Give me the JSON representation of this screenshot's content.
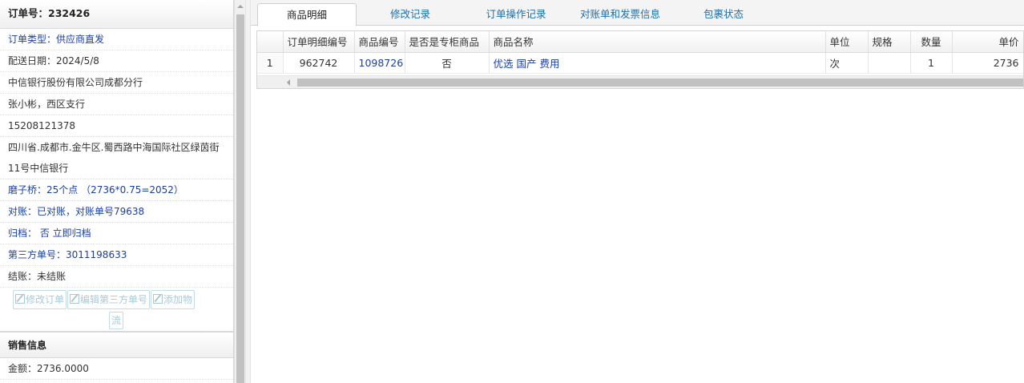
{
  "order": {
    "header_label": "订单号：232426",
    "rows": [
      {
        "text": "订单类型：供应商直发",
        "style": "blue"
      },
      {
        "text": "配送日期：2024/5/8",
        "style": "plain"
      },
      {
        "text": "中信银行股份有限公司成都分行",
        "style": "plain"
      },
      {
        "text": "张小彬，西区支行",
        "style": "plain"
      },
      {
        "text": "15208121378",
        "style": "plain"
      },
      {
        "text": "四川省.成都市.金牛区.蜀西路中海国际社区绿茵街11号中信银行",
        "style": "wrap"
      },
      {
        "text": "磨子桥：25个点  （2736*0.75=2052）",
        "style": "blue"
      },
      {
        "text": "对账：已对账，对账单号79638",
        "style": "blue"
      },
      {
        "text": "归档：  否 立即归档",
        "style": "blue"
      },
      {
        "text": "第三方单号：3011198633",
        "style": "blue"
      },
      {
        "text": "结账：未结账",
        "style": "plain"
      }
    ],
    "buttons": {
      "edit_order": "修改订单",
      "edit_third_party": "编辑第三方单号",
      "add_logistics": "添加物",
      "add_logistics_wrap": "流"
    }
  },
  "sales": {
    "header_label": "销售信息",
    "amount": "金额：2736.0000"
  },
  "tabs": [
    {
      "label": "商品明细",
      "active": true
    },
    {
      "label": "修改记录",
      "active": false
    },
    {
      "label": "订单操作记录",
      "active": false
    },
    {
      "label": "对账单和发票信息",
      "active": false
    },
    {
      "label": "包裹状态",
      "active": false
    }
  ],
  "grid": {
    "columns": [
      "",
      "订单明细编号",
      "商品编号",
      "是否是专柜商品",
      "商品名称",
      "单位",
      "规格",
      "数量",
      "单价"
    ],
    "rows": [
      {
        "row_no": "1",
        "detail_id": "962742",
        "product_id": "1098726",
        "is_counter": "否",
        "name": "优选 国产 费用",
        "unit": "次",
        "spec": "",
        "qty": "1",
        "price": "2736"
      }
    ]
  },
  "colors": {
    "link_blue": "#1a3fa6",
    "tab_blue": "#1a6fb0",
    "disabled_button": "#a9c9d6"
  }
}
